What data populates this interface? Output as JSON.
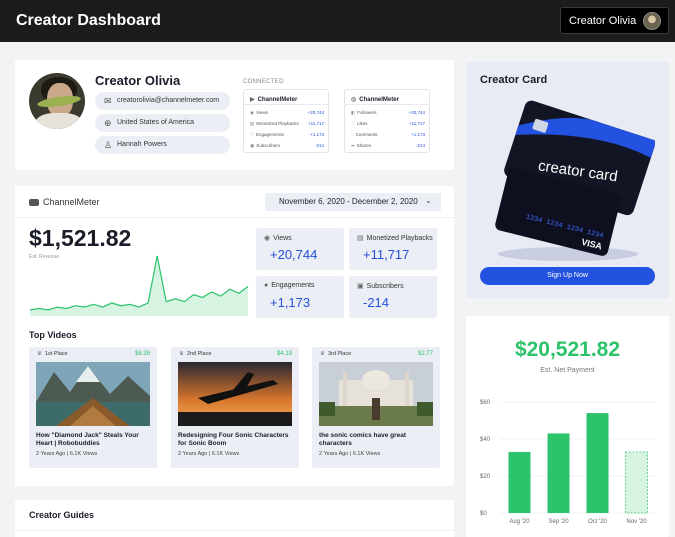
{
  "header": {
    "title": "Creator Dashboard",
    "user_name": "Creator Olivia"
  },
  "profile": {
    "name": "Creator Olivia",
    "email": "creatorolivia@channelmeter.com",
    "country": "United States of America",
    "manager": "Hannah Powers",
    "connected_label": "CONNECTED",
    "accounts": [
      {
        "name": "ChannelMeter",
        "icon": "youtube-icon",
        "rows": [
          {
            "label": "Views",
            "value": "+20,744"
          },
          {
            "label": "Monetized Playbacks",
            "value": "+11,717"
          },
          {
            "label": "Engagements",
            "value": "+1,173"
          },
          {
            "label": "Subscribers",
            "value": "-214"
          }
        ]
      },
      {
        "name": "ChannelMeter",
        "icon": "instagram-icon",
        "rows": [
          {
            "label": "Followers",
            "value": "+20,744"
          },
          {
            "label": "Likes",
            "value": "+11,717"
          },
          {
            "label": "Comments",
            "value": "+1,173"
          },
          {
            "label": "Shares",
            "value": "-214"
          }
        ]
      }
    ]
  },
  "analytics": {
    "channel": "ChannelMeter",
    "date_range": "November 6, 2020 - December 2, 2020",
    "revenue": "$1,521.82",
    "revenue_label": "Est. Revenue",
    "stats": [
      {
        "label": "Views",
        "value": "+20,744"
      },
      {
        "label": "Monetized Playbacks",
        "value": "+11,717"
      },
      {
        "label": "Engagements",
        "value": "+1,173"
      },
      {
        "label": "Subscribers",
        "value": "-214"
      }
    ],
    "top_videos_title": "Top Videos",
    "videos": [
      {
        "place": "1st Place",
        "earn": "$8.39",
        "title": "How \"Diamond Jack\" Steals Your Heart | Robobuddies",
        "meta": "2 Years Ago | 6.1K Views"
      },
      {
        "place": "2nd Place",
        "earn": "$4.19",
        "title": "Redesigning Four Sonic Characters for Sonic Boom",
        "meta": "2 Years Ago | 6.1K Views"
      },
      {
        "place": "3rd Place",
        "earn": "$2.77",
        "title": "the sonic comics have great characters",
        "meta": "2 Years Ago | 6.1K Views"
      }
    ]
  },
  "guides": {
    "title": "Creator Guides"
  },
  "creator_card": {
    "title": "Creator Card",
    "card_text": "creator card",
    "card_number": "1234 1234 1234 1234",
    "card_brand": "VISA",
    "button": "Sign Up Now"
  },
  "net_payment": {
    "amount": "$20,521.82",
    "label": "Est. Net Payment"
  },
  "colors": {
    "accent_blue": "#2452e0",
    "accent_green": "#2cc36b",
    "header_bg": "#1c1c1c"
  },
  "chart_data": {
    "type": "bar",
    "categories": [
      "Aug '20",
      "Sep '20",
      "Oct '20",
      "Nov '20"
    ],
    "values": [
      33,
      43,
      54,
      33
    ],
    "projected": [
      false,
      false,
      false,
      true
    ],
    "ylim": [
      0,
      60
    ],
    "yticks": [
      "$0",
      "$20",
      "$40",
      "$60"
    ],
    "grid": true
  },
  "revenue_trend": [
    3,
    4,
    3,
    5,
    4,
    6,
    5,
    7,
    5,
    8,
    6,
    7,
    5,
    8,
    42,
    9,
    11,
    9,
    14,
    12,
    16,
    13,
    18,
    15,
    20
  ]
}
